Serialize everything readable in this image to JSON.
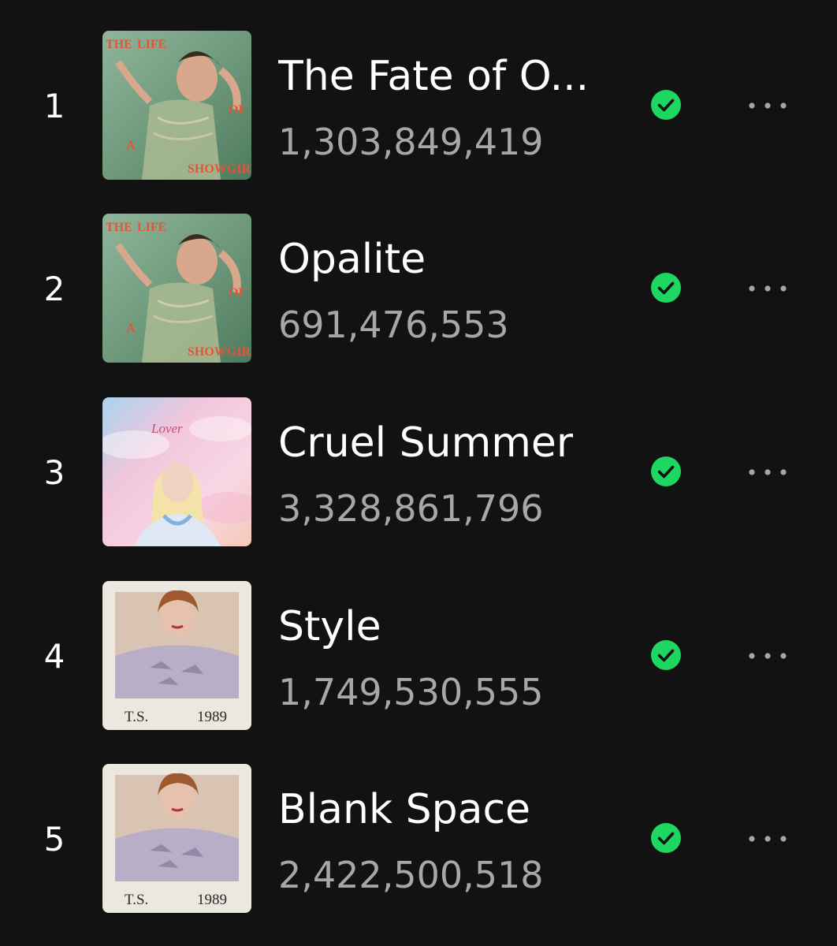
{
  "colors": {
    "background": "#121212",
    "text_primary": "#ffffff",
    "text_secondary": "#a7a7a7",
    "saved_green": "#1ed760"
  },
  "tracks": [
    {
      "rank": "1",
      "title": "The Fate of O...",
      "plays": "1,303,849,419",
      "cover": "the-life-of-a-showgirl",
      "saved_icon": "check-circle-icon",
      "more_icon": "more-options-icon"
    },
    {
      "rank": "2",
      "title": "Opalite",
      "plays": "691,476,553",
      "cover": "the-life-of-a-showgirl",
      "saved_icon": "check-circle-icon",
      "more_icon": "more-options-icon"
    },
    {
      "rank": "3",
      "title": "Cruel Summer",
      "plays": "3,328,861,796",
      "cover": "lover",
      "saved_icon": "check-circle-icon",
      "more_icon": "more-options-icon"
    },
    {
      "rank": "4",
      "title": "Style",
      "plays": "1,749,530,555",
      "cover": "1989",
      "saved_icon": "check-circle-icon",
      "more_icon": "more-options-icon"
    },
    {
      "rank": "5",
      "title": "Blank Space",
      "plays": "2,422,500,518",
      "cover": "1989",
      "saved_icon": "check-circle-icon",
      "more_icon": "more-options-icon"
    }
  ],
  "cover_text": {
    "the-life-of-a-showgirl": [
      "THE",
      "LIFE",
      "OF",
      "A",
      "SHOWGIRL"
    ],
    "lover": [
      "Lover"
    ],
    "1989": [
      "T.S.",
      "1989"
    ]
  }
}
